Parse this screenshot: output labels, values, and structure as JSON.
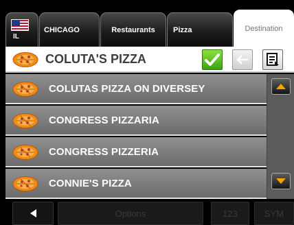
{
  "tabs": {
    "state_code": "IL",
    "city": "CHICAGO",
    "category": "Restaurants",
    "subcategory": "Pizza",
    "destination": "Destination"
  },
  "header": {
    "title": "COLUTA'S PIZZA",
    "icon": "pizza-icon",
    "ok_icon": "checkmark-icon",
    "back_icon": "back-arrow-icon",
    "list_icon": "list-icon"
  },
  "results": [
    {
      "name": "COLUTAS PIZZA ON DIVERSEY",
      "icon": "pizza-icon"
    },
    {
      "name": "CONGRESS PIZZARIA",
      "icon": "pizza-icon"
    },
    {
      "name": "CONGRESS PIZZERIA",
      "icon": "pizza-icon"
    },
    {
      "name": "CONNIE'S PIZZA",
      "icon": "pizza-icon"
    }
  ],
  "bottom": {
    "options_label": "Options",
    "num_label": "123",
    "sym_label": "SYM"
  },
  "colors": {
    "accent_green": "#4cb51f",
    "row_gray": "#7d7d7d",
    "scroll_arrow": "#f5a300",
    "pizza_orange": "#ef8a1a"
  }
}
